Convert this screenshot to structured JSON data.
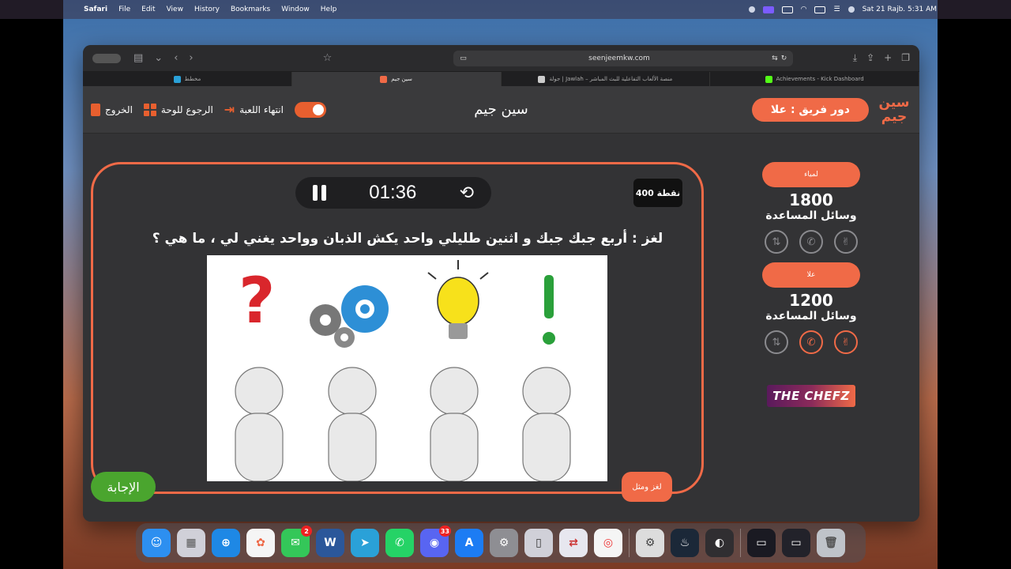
{
  "menubar": {
    "app_name": "Safari",
    "menus": [
      "File",
      "Edit",
      "View",
      "History",
      "Bookmarks",
      "Window",
      "Help"
    ],
    "datetime": "Sat 21 Rajb. 5:31 AM"
  },
  "browser": {
    "url": "seenjeemkw.com",
    "tabs": [
      {
        "label": "مخطط",
        "favicon_color": "#2aa1d8",
        "active": false
      },
      {
        "label": "سين جيم",
        "favicon_color": "#f06a47",
        "active": true
      },
      {
        "label": "جولة | Jawlah – منصة الألعاب التفاعلية للبث المباشر",
        "favicon_color": "#cccccc",
        "active": false
      },
      {
        "label": "Achievements - Kick Dashboard",
        "favicon_color": "#53fc18",
        "active": false
      }
    ]
  },
  "header": {
    "exit_label": "الخروج",
    "back_to_board_label": "الرجوع للوحة",
    "end_game_label": "انتهاء اللعبة",
    "title": "سين جيم",
    "turn_label": "دور فريق : علا",
    "logo_text": "سين جيم"
  },
  "game": {
    "timer": "01:36",
    "points": "400 نقطة",
    "question": "لغز : أربع جبك جبك و اثنين طليلي واحد يكش الذبان وواحد يغني لي ، ما هي ؟",
    "answer_label": "الإجابة",
    "category_tag": "لغز ومثل",
    "image_alt": "أربع شخصيات بيضاء: علامة استفهام، تروس، مصباح، علامة تعجب"
  },
  "teams": [
    {
      "name": "لمياء",
      "score": "1800",
      "helps_label": "وسائل المساعدة",
      "helps": [
        false,
        false,
        false
      ]
    },
    {
      "name": "علا",
      "score": "1200",
      "helps_label": "وسائل المساعدة",
      "helps": [
        false,
        true,
        true
      ]
    }
  ],
  "sponsor": {
    "text": "THE CHEFZ"
  },
  "dock": {
    "apps": [
      {
        "name": "Finder",
        "color": "#2d8ff0",
        "glyph": "☺"
      },
      {
        "name": "Launchpad",
        "color": "#d0d0d8",
        "glyph": "▦"
      },
      {
        "name": "Safari",
        "color": "#1e88e5",
        "glyph": "⊕"
      },
      {
        "name": "Photos",
        "color": "#f5f5f5",
        "glyph": "✿"
      },
      {
        "name": "Messages",
        "color": "#34c759",
        "glyph": "✉",
        "badge": "2"
      },
      {
        "name": "Word",
        "color": "#2b579a",
        "glyph": "W"
      },
      {
        "name": "Telegram",
        "color": "#2aa1d8",
        "glyph": "➤"
      },
      {
        "name": "WhatsApp",
        "color": "#25d366",
        "glyph": "✆"
      },
      {
        "name": "Discord",
        "color": "#5865f2",
        "glyph": "◉",
        "badge": "33"
      },
      {
        "name": "App Store",
        "color": "#1c7cf4",
        "glyph": "A"
      },
      {
        "name": "System Settings",
        "color": "#8e8e93",
        "glyph": "⚙"
      },
      {
        "name": "iPhone Mirroring",
        "color": "#d0d0d8",
        "glyph": "▯"
      },
      {
        "name": "Remote Desktop",
        "color": "#e7e7ef",
        "glyph": "⇄"
      },
      {
        "name": "Chrome",
        "color": "#f5f5f5",
        "glyph": "◎"
      },
      {
        "name": "Automator",
        "color": "#dcdcdc",
        "glyph": "⚙"
      },
      {
        "name": "Steam",
        "color": "#1b2838",
        "glyph": "♨"
      },
      {
        "name": "OBS",
        "color": "#302e31",
        "glyph": "◐"
      },
      {
        "name": "Window 1",
        "color": "#1a1a22",
        "glyph": "▭"
      },
      {
        "name": "Window 2",
        "color": "#22222a",
        "glyph": "▭"
      },
      {
        "name": "Trash",
        "color": "#bfc3c9",
        "glyph": "🗑"
      }
    ]
  }
}
